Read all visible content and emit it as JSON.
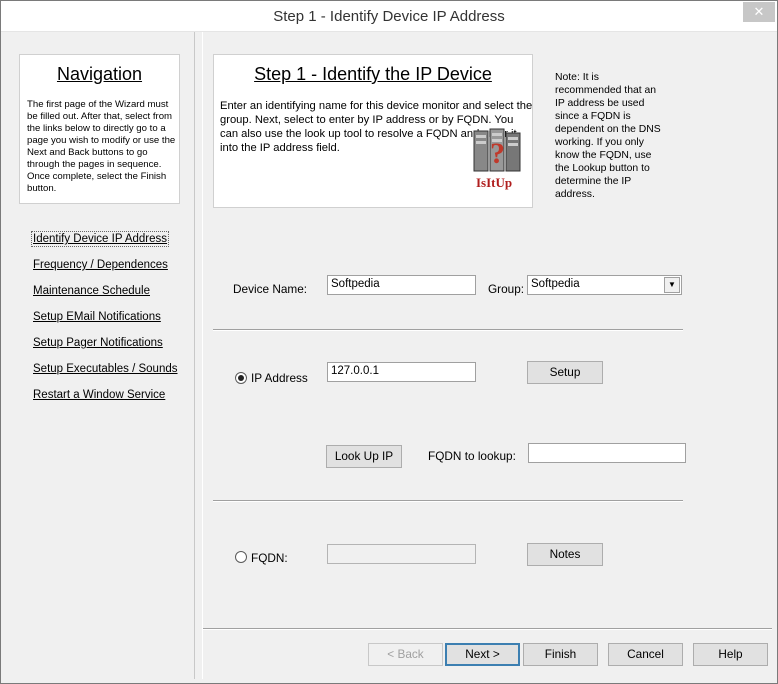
{
  "window": {
    "title": "Step 1 - Identify Device IP Address",
    "close_glyph": "✕"
  },
  "navigation": {
    "title": "Navigation",
    "description": "The first page of the Wizard must be filled out. After that, select from the links below to directly go to a page you wish to modify or use the Next and Back buttons to go through the pages in sequence. Once complete, select the Finish button.",
    "links": [
      "Identify Device IP Address",
      "Frequency / Dependences",
      "Maintenance Schedule",
      "Setup EMail Notifications",
      "Setup Pager Notifications",
      "Setup Executables / Sounds",
      "Restart a Window Service"
    ]
  },
  "step": {
    "title": "Step 1 - Identify the IP Device",
    "description": "Enter an identifying name for this device monitor and select the group. Next, select to enter by IP address or by FQDN.  You can also use the look up tool to resolve a FQDN and enter it into the IP address field.",
    "logo_text": "IsItUp",
    "note": "Note: It is recommended that an IP address be used since a FQDN is dependent on the DNS working.  If you only know the FQDN, use the Lookup button to determine the IP address."
  },
  "form": {
    "device_name_label": "Device Name:",
    "device_name_value": "Softpedia",
    "group_label": "Group:",
    "group_value": "Softpedia",
    "ip_radio_label": "IP Address",
    "ip_value": "127.0.0.1",
    "setup_button": "Setup",
    "lookup_button": "Look Up IP",
    "fqdn_lookup_label": "FQDN to lookup:",
    "fqdn_lookup_value": "",
    "fqdn_radio_label": "FQDN:",
    "fqdn_value": "",
    "notes_button": "Notes",
    "ip_selected": true
  },
  "footer": {
    "back": "< Back",
    "next": "Next >",
    "finish": "Finish",
    "cancel": "Cancel",
    "help": "Help"
  }
}
